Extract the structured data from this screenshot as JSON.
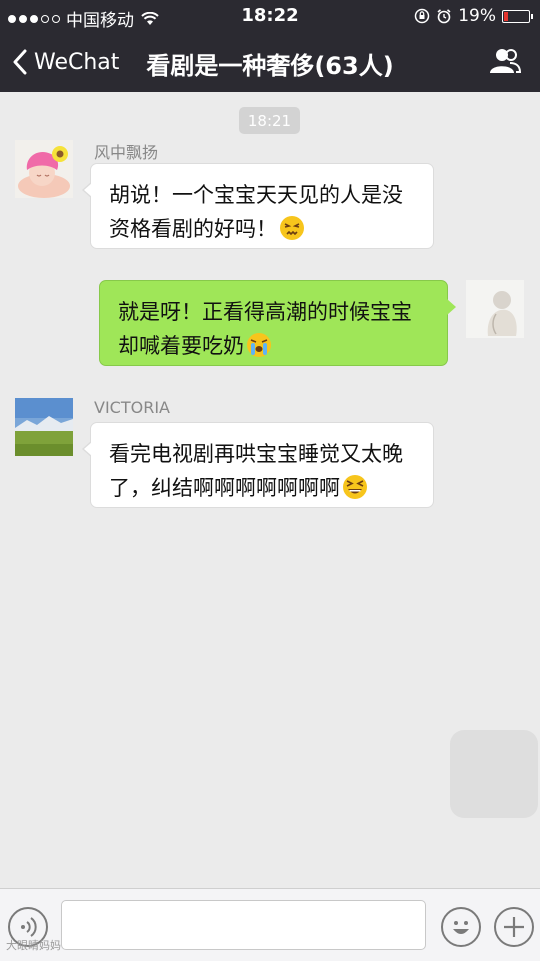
{
  "status_bar": {
    "carrier": "中国移动",
    "time": "18:22",
    "battery_percent": "19%",
    "battery_level": 0.19,
    "signal_bars_filled": 3,
    "signal_bars_total": 5
  },
  "nav": {
    "back_label": "WeChat",
    "title": "看剧是一种奢侈(63人)",
    "bg_color": "#2b2a31"
  },
  "chat": {
    "timestamp": "18:21",
    "messages": [
      {
        "sender": "风中飘扬",
        "text": "胡说！一个宝宝天天见的人是没资格看剧的好吗！",
        "emoji": "persevering-face",
        "direction": "incoming"
      },
      {
        "sender": "",
        "text": "就是呀！正看得高潮的时候宝宝却喊着要吃奶",
        "emoji": "crying-face",
        "direction": "outgoing"
      },
      {
        "sender": "VICTORIA",
        "text": "看完电视剧再哄宝宝睡觉又太晚了，纠结啊啊啊啊啊啊啊",
        "emoji": "grinning-squint-face",
        "direction": "incoming"
      }
    ],
    "bubble_out_color": "#9fe658",
    "bubble_in_color": "#ffffff"
  },
  "input": {
    "value": ""
  },
  "watermark": "大眼睛妈妈"
}
